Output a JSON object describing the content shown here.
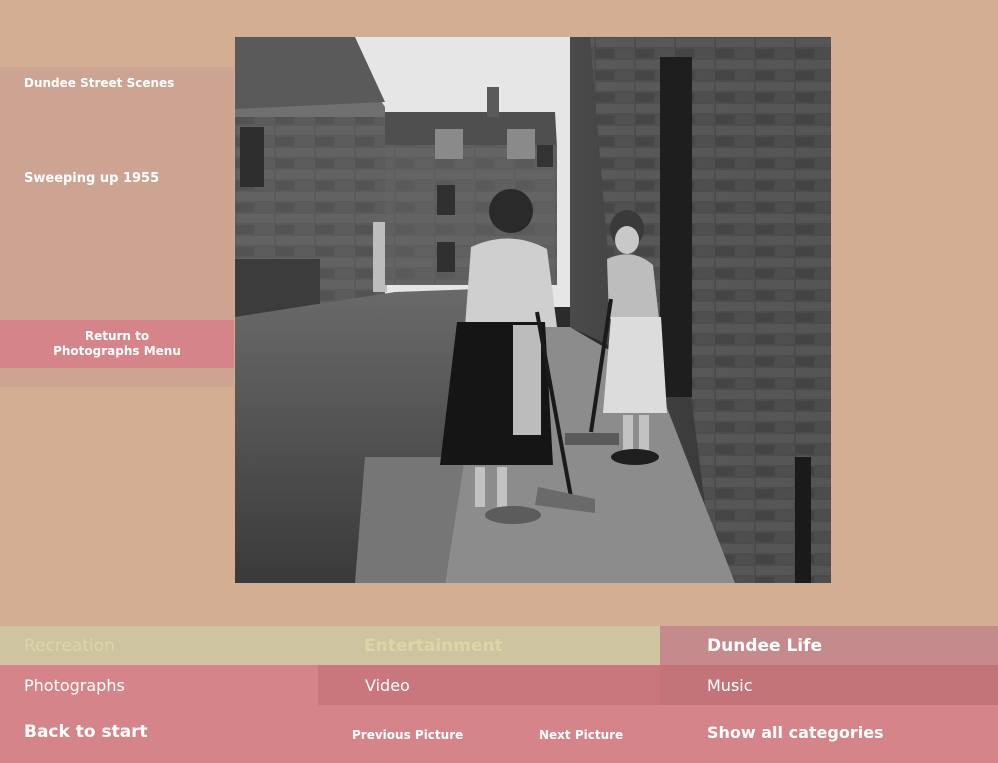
{
  "sidebar": {
    "series_title": "Dundee Street Scenes",
    "photo_title": "Sweeping up 1955",
    "return_label": "Return to\nPhotographs Menu"
  },
  "nav": {
    "tabs": [
      {
        "label": "Recreation",
        "state": "inactive"
      },
      {
        "label": "Entertainment",
        "state": "inactive"
      },
      {
        "label": "Dundee Life",
        "state": "active"
      }
    ],
    "subtabs": [
      {
        "label": "Photographs",
        "state": "active"
      },
      {
        "label": "Video"
      },
      {
        "label": "Music"
      }
    ]
  },
  "footer": {
    "back_label": "Back to start",
    "prev_label": "Previous Picture",
    "next_label": "Next Picture",
    "show_all_label": "Show all categories"
  },
  "colors": {
    "background": "#d4ae92",
    "panel": "#cda491",
    "accent_pink": "#d5858a",
    "inactive_tab": "#cec5a0"
  }
}
